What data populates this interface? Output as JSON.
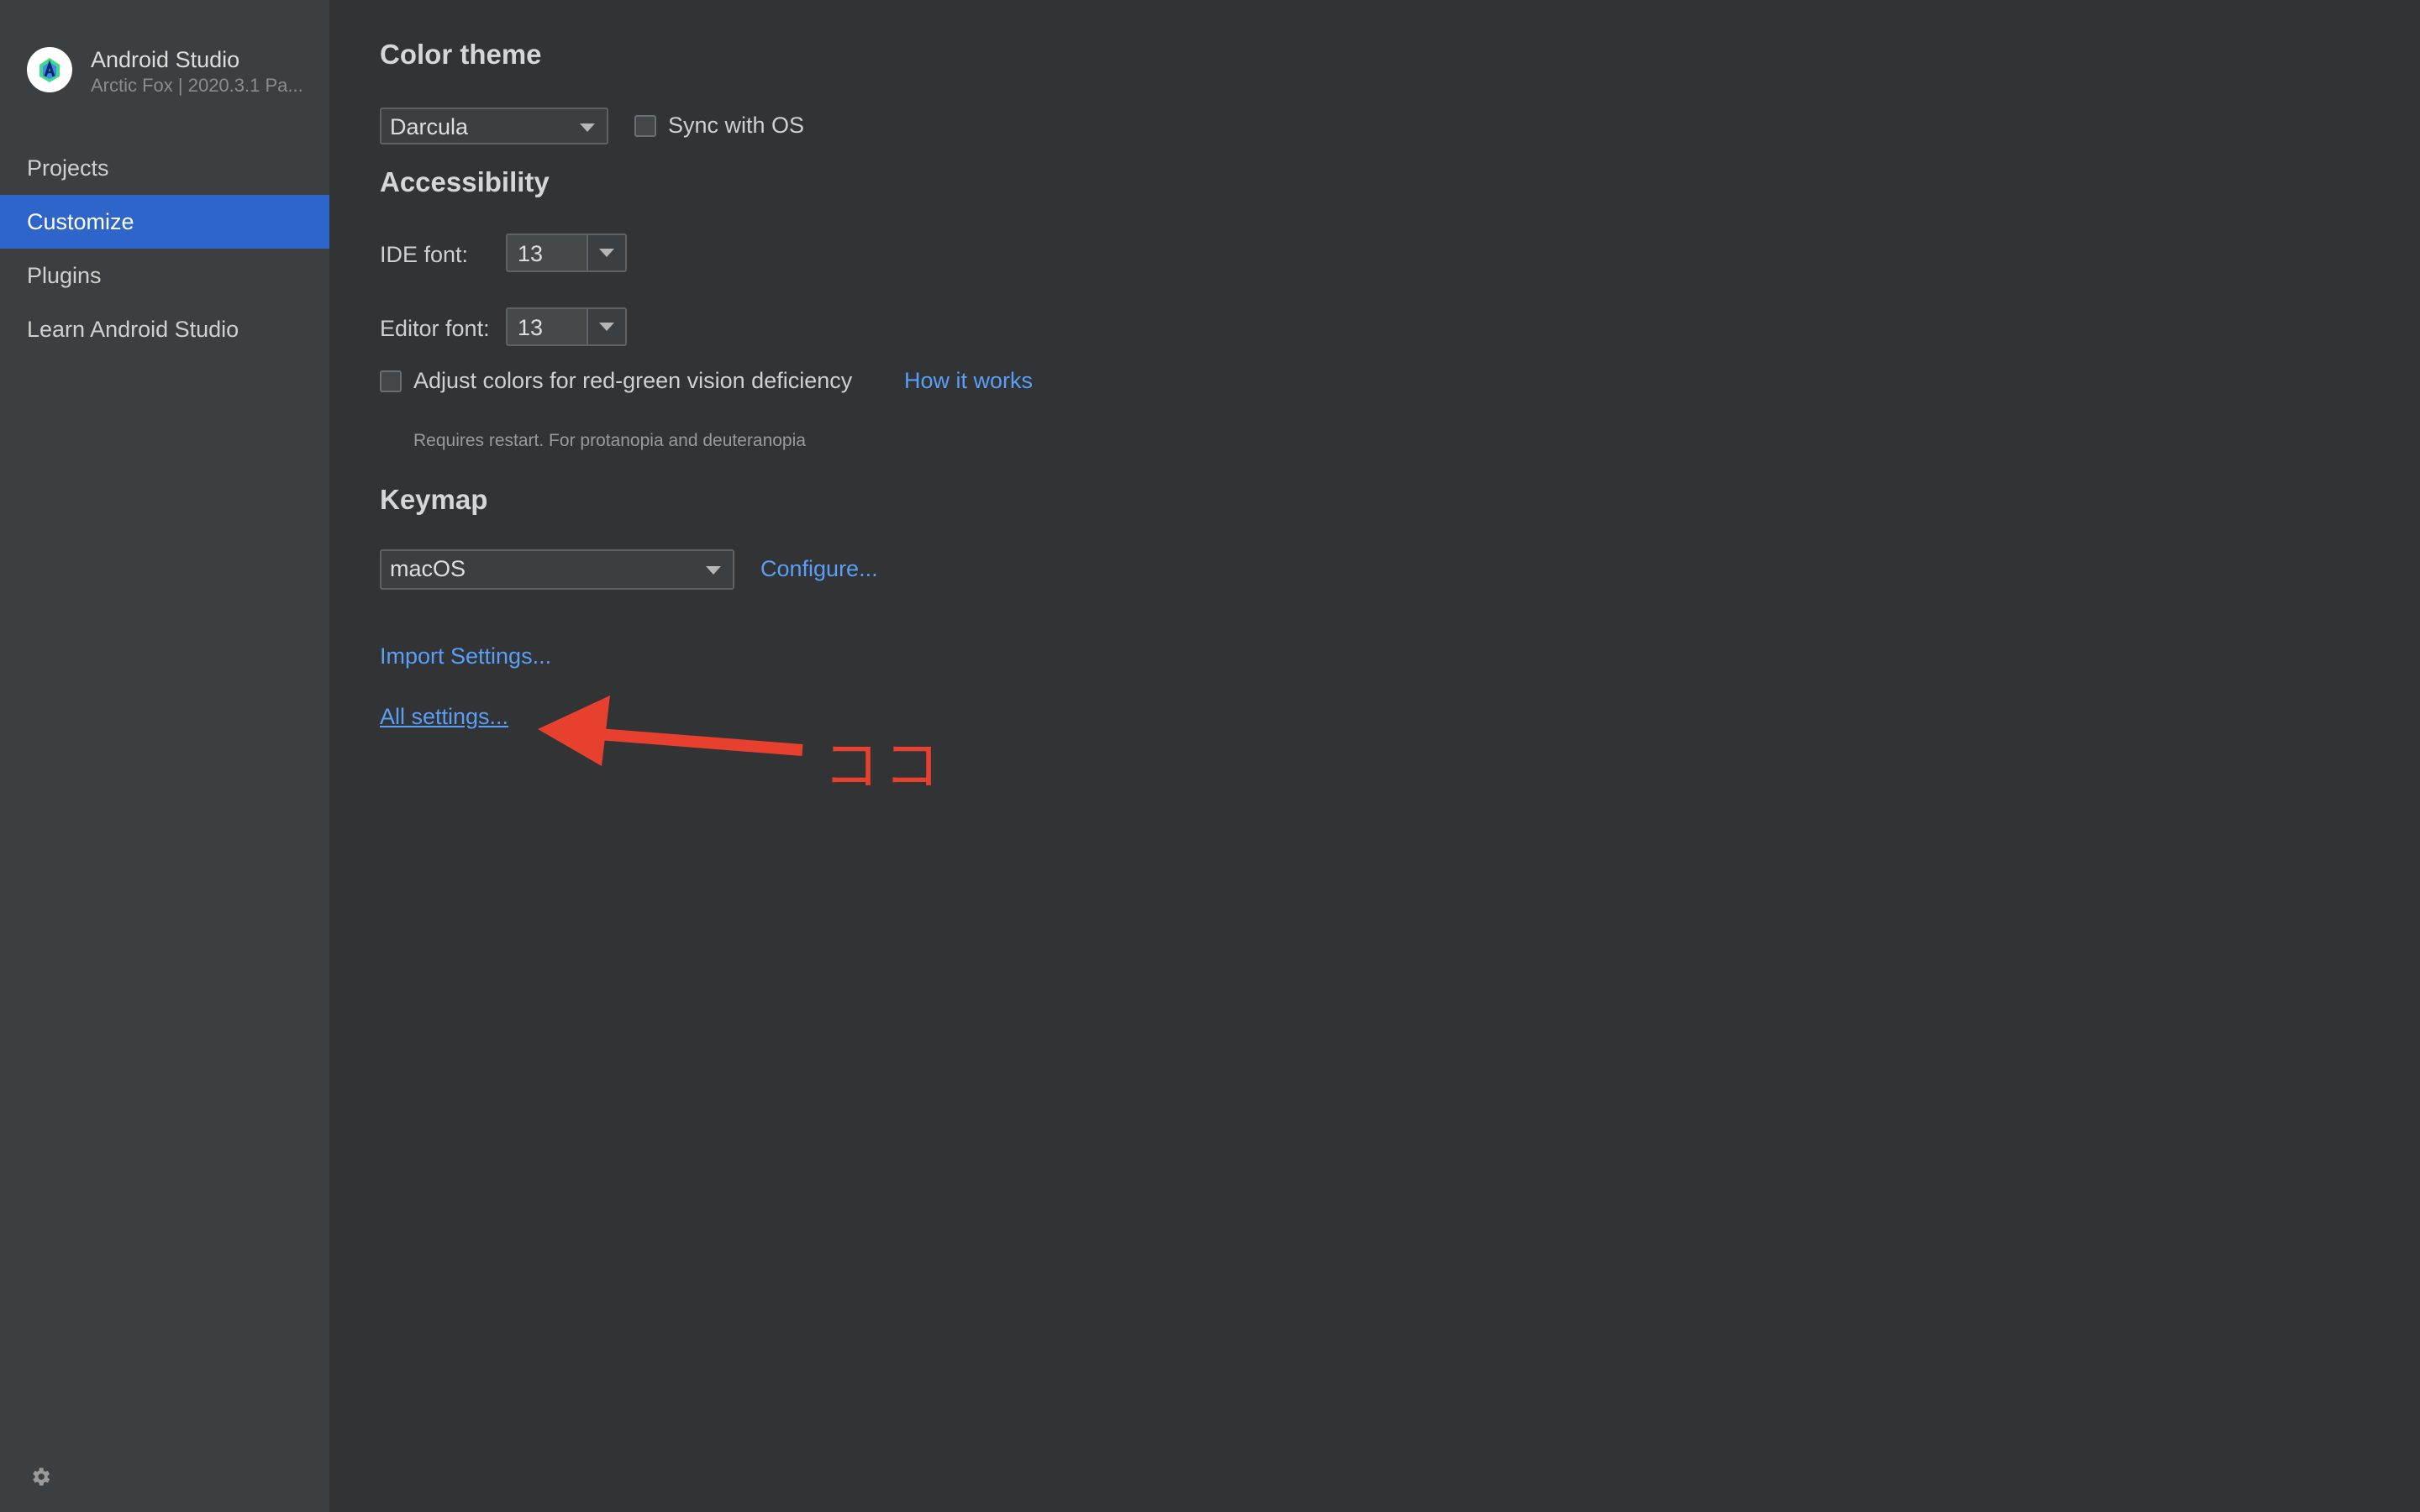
{
  "app": {
    "name": "Android Studio",
    "version": "Arctic Fox | 2020.3.1 Pa...",
    "logo_icon": "android-studio-logo"
  },
  "sidebar": {
    "items": [
      {
        "label": "Projects",
        "active": false
      },
      {
        "label": "Customize",
        "active": true
      },
      {
        "label": "Plugins",
        "active": false
      },
      {
        "label": "Learn Android Studio",
        "active": false
      }
    ],
    "settings_icon": "gear-icon"
  },
  "customize": {
    "color_theme": {
      "title": "Color theme",
      "theme_value": "Darcula",
      "sync_label": "Sync with OS",
      "sync_checked": false
    },
    "accessibility": {
      "title": "Accessibility",
      "ide_font_label": "IDE font:",
      "ide_font_value": "13",
      "editor_font_label": "Editor font:",
      "editor_font_value": "13",
      "adjust_colors_label": "Adjust colors for red-green vision deficiency",
      "adjust_colors_checked": false,
      "how_it_works": "How it works",
      "hint": "Requires restart. For protanopia and deuteranopia"
    },
    "keymap": {
      "title": "Keymap",
      "value": "macOS",
      "configure": "Configure..."
    },
    "import_settings": "Import Settings...",
    "all_settings": "All settings..."
  },
  "annotation": {
    "text": "ココ",
    "color": "#e8402f"
  },
  "colors": {
    "accent": "#2e65ca",
    "link": "#5a9ef6",
    "sidebar_bg": "#3c3f41",
    "main_bg": "#313335"
  }
}
